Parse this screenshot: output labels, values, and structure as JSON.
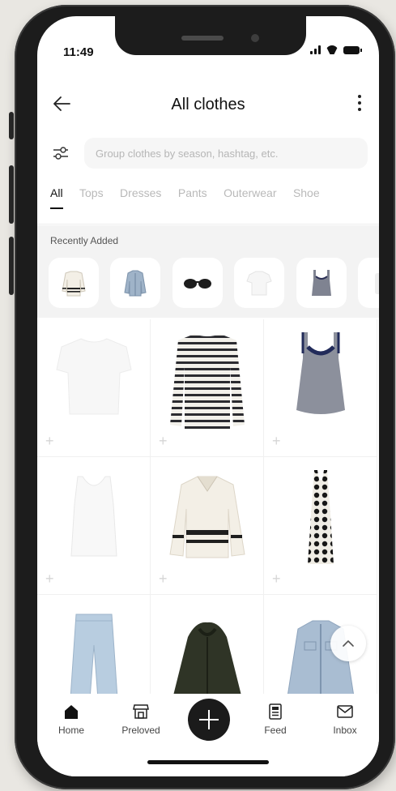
{
  "status_bar": {
    "time": "11:49"
  },
  "header": {
    "title": "All clothes"
  },
  "search": {
    "placeholder": "Group clothes by season, hashtag, etc."
  },
  "tabs": [
    {
      "label": "All",
      "active": true
    },
    {
      "label": "Tops"
    },
    {
      "label": "Dresses"
    },
    {
      "label": "Pants"
    },
    {
      "label": "Outerwear"
    },
    {
      "label": "Shoe"
    }
  ],
  "recent": {
    "title": "Recently Added",
    "items": [
      {
        "icon": "striped-sweater-icon"
      },
      {
        "icon": "denim-jacket-icon"
      },
      {
        "icon": "sunglasses-icon"
      },
      {
        "icon": "white-tee-icon"
      },
      {
        "icon": "gray-tank-icon"
      },
      {
        "icon": "item-icon"
      }
    ]
  },
  "grid_items": [
    {
      "icon": "white-tee-icon"
    },
    {
      "icon": "striped-shirt-icon"
    },
    {
      "icon": "gray-tank-icon"
    },
    {
      "icon": "white-tank-icon"
    },
    {
      "icon": "striped-sweater-icon"
    },
    {
      "icon": "polka-dot-dress-icon"
    },
    {
      "icon": "jeans-icon"
    },
    {
      "icon": "fur-jacket-icon"
    },
    {
      "icon": "denim-jacket-icon"
    }
  ],
  "bottom_nav": {
    "home": "Home",
    "preloved": "Preloved",
    "feed": "Feed",
    "inbox": "Inbox"
  },
  "colors": {
    "accent": "#1b1b1b",
    "background": "#ffffff",
    "muted_text": "#b9b9b9"
  }
}
